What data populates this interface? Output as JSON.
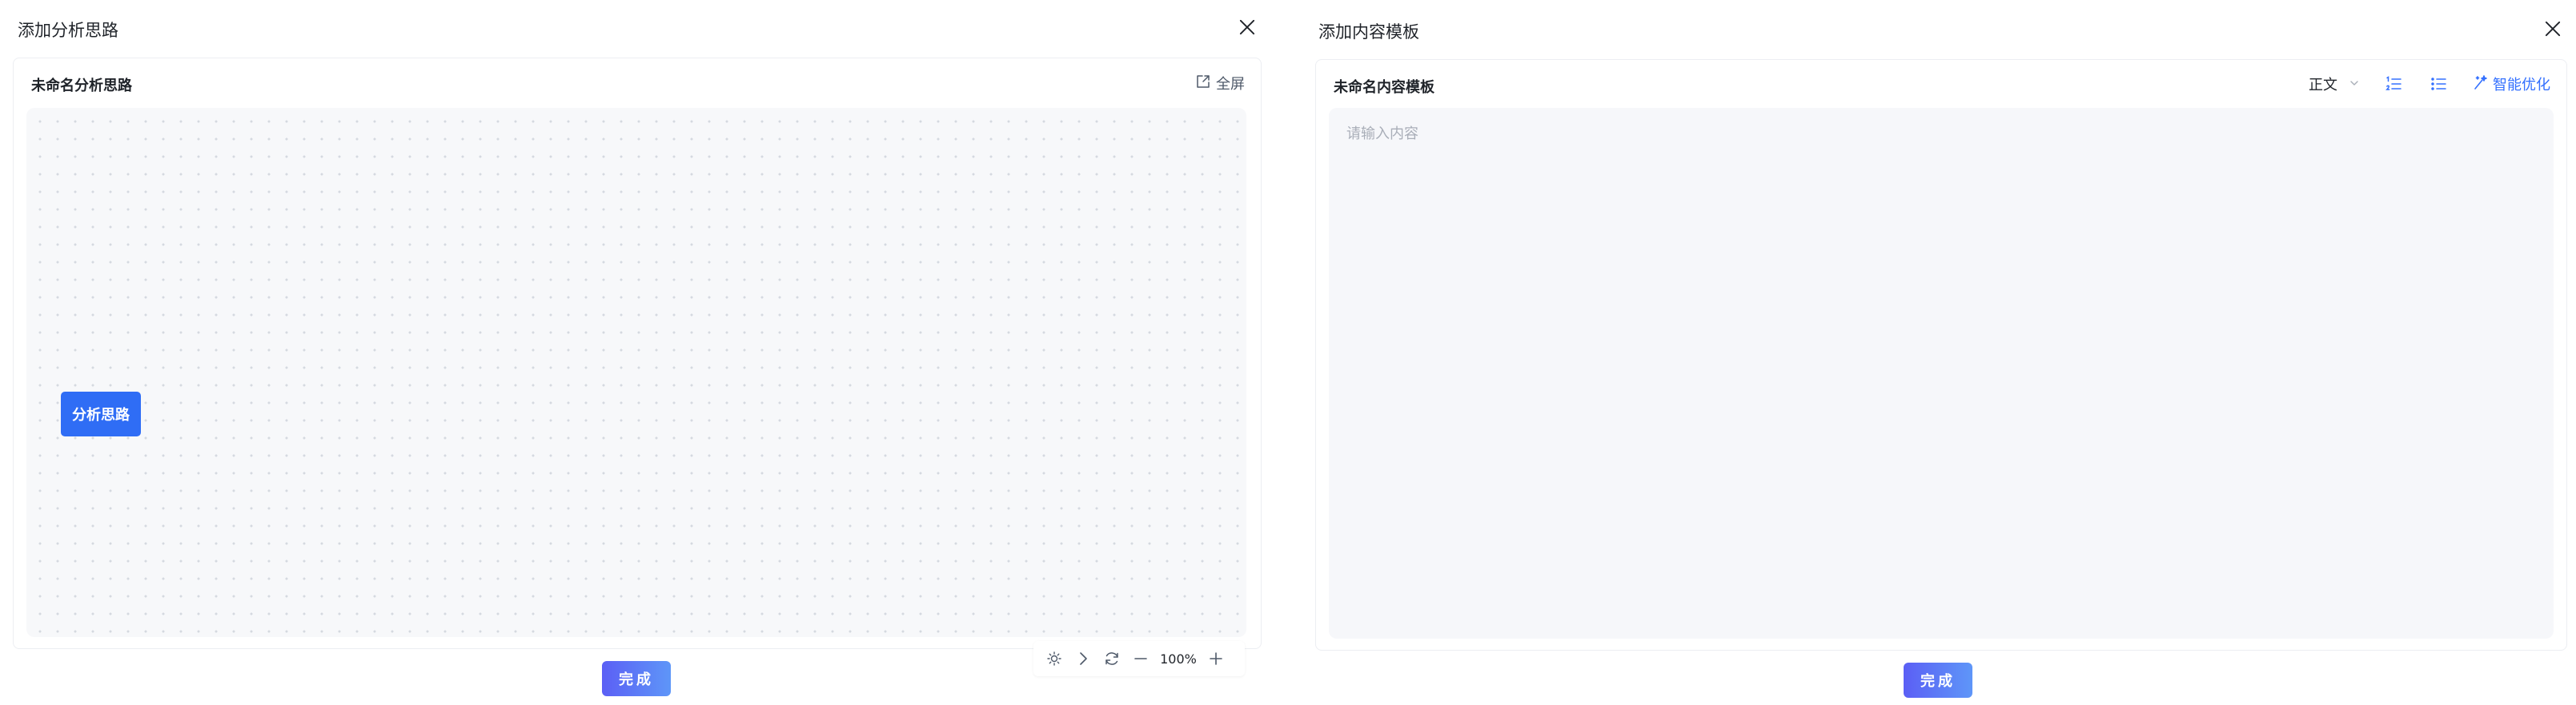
{
  "left_dialog": {
    "title": "添加分析思路",
    "card_title": "未命名分析思路",
    "fullscreen_label": "全屏",
    "node_label": "分析思路",
    "zoom_level": "100%",
    "done_label": "完成"
  },
  "right_dialog": {
    "title": "添加内容模板",
    "card_title": "未命名内容模板",
    "text_style": "正文",
    "ai_label": "智能优化",
    "editor_placeholder": "请输入内容",
    "done_label": "完成"
  },
  "icons": {
    "close": "close-icon",
    "fullscreen": "expand-icon",
    "lightbulb": "lightbulb-icon",
    "chevron_right": "chevron-right-icon",
    "refresh": "refresh-icon",
    "minus": "zoom-out-icon",
    "plus": "zoom-in-icon",
    "chevron_down": "chevron-down-icon",
    "ordered_list": "ordered-list-icon",
    "bullet_list": "bullet-list-icon",
    "magic": "magic-wand-icon"
  },
  "colors": {
    "primary": "#2f6df5",
    "accent_link": "#3370ff",
    "button_gradient_start": "#5b5ff5",
    "button_gradient_end": "#5e96f8",
    "canvas_bg": "#f7f8fa",
    "editor_bg": "#f6f7fa"
  }
}
